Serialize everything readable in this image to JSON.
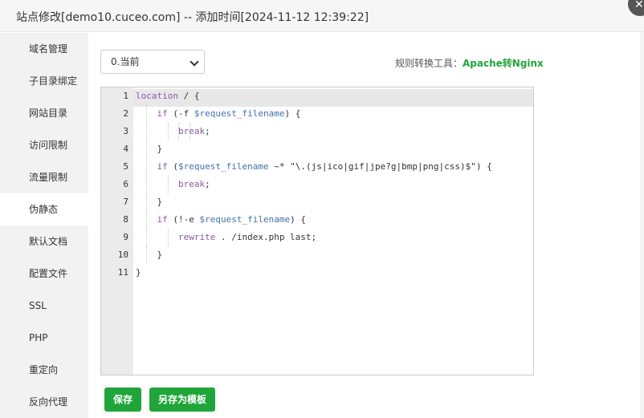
{
  "window": {
    "title": "站点修改[demo10.cuceo.com] -- 添加时间[2024-11-12 12:39:22]",
    "close_glyph": "✕"
  },
  "sidebar": {
    "items": [
      {
        "label": "域名管理"
      },
      {
        "label": "子目录绑定"
      },
      {
        "label": "网站目录"
      },
      {
        "label": "访问限制"
      },
      {
        "label": "流量限制"
      },
      {
        "label": "伪静态",
        "active": true
      },
      {
        "label": "默认文档"
      },
      {
        "label": "配置文件"
      },
      {
        "label": "SSL"
      },
      {
        "label": "PHP"
      },
      {
        "label": "重定向"
      },
      {
        "label": "反向代理"
      }
    ]
  },
  "toolbar": {
    "version_select_value": "0.当前",
    "tool_label": "规则转换工具：",
    "tool_link": "Apache转Nginx"
  },
  "editor": {
    "active_line": 1,
    "line_numbers": [
      "1",
      "2",
      "3",
      "4",
      "5",
      "6",
      "7",
      "8",
      "9",
      "10",
      "11"
    ],
    "lines": [
      "location / {",
      "    if (-f $request_filename) {",
      "        break;",
      "    }",
      "    if ($request_filename ~* \"\\.(js|ico|gif|jpe?g|bmp|png|css)$\") {",
      "        break;",
      "    }",
      "    if (!-e $request_filename) {",
      "        rewrite . /index.php last;",
      "    }",
      "}"
    ]
  },
  "actions": {
    "save_label": "保存",
    "save_template_label": "另存为模板"
  },
  "colors": {
    "accent": "#20a53a",
    "keyword": "#8959a8",
    "variable": "#4271ae"
  }
}
